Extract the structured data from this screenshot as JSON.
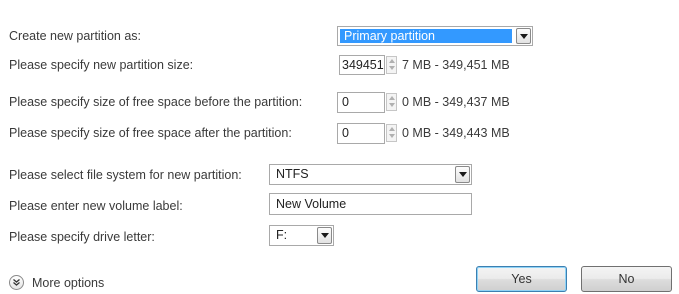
{
  "rows": {
    "partition_type": {
      "label": "Create new partition as:",
      "value": "Primary partition"
    },
    "partition_size": {
      "label": "Please specify new partition size:",
      "value": "349451",
      "range": "7 MB - 349,451 MB"
    },
    "space_before": {
      "label": "Please specify size of free space before the partition:",
      "value": "0",
      "range": "0 MB - 349,437 MB"
    },
    "space_after": {
      "label": "Please specify size of free space after the partition:",
      "value": "0",
      "range": "0 MB - 349,443 MB"
    },
    "file_system": {
      "label": "Please select file system for new partition:",
      "value": "NTFS"
    },
    "volume_label": {
      "label": "Please enter new volume label:",
      "value": "New Volume"
    },
    "drive_letter": {
      "label": "Please specify drive letter:",
      "value": "F:"
    }
  },
  "footer": {
    "more_options": "More options",
    "yes_label": "Yes",
    "no_label": "No"
  },
  "colors": {
    "selection": "#3399ff",
    "selection_text": "#ffffff"
  },
  "icons": {
    "more_options": "double-chevron-down-icon",
    "dropdown": "dropdown-arrow-icon",
    "spinner": "spinner-arrows-icon"
  }
}
